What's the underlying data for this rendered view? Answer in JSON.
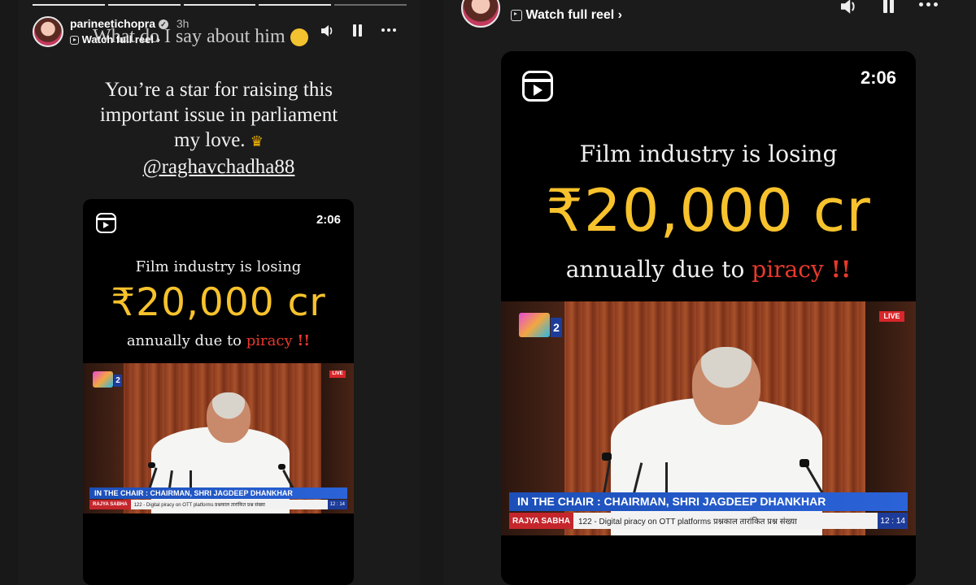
{
  "left_story": {
    "username": "parineetichopra",
    "time_ago": "3h",
    "watch_full_reel": "Watch full reel",
    "overlap_caption": "What do I say about him",
    "caption_lines": [
      "You’re a star for raising this",
      "important issue in parliament",
      "my love."
    ],
    "mention": "@raghavchadha88"
  },
  "reel": {
    "duration": "2:06",
    "line1": "Film industry is losing",
    "amount": "₹20,000 cr",
    "line3_prefix": "annually due to",
    "line3_highlight": "piracy",
    "line3_marks": "!!",
    "channel_number": "2",
    "live_label": "LIVE",
    "chair_caption": "IN THE CHAIR : CHAIRMAN, SHRI JAGDEEP DHANKHAR",
    "ticker_channel": "RAJYA SABHA",
    "ticker_text": "122 - Digital piracy on OTT platforms प्रश्नकाल  तारांकित प्रश्न संख्या",
    "ticker_time": "12 : 14"
  },
  "right_story": {
    "watch_full_reel": "Watch full reel"
  },
  "colors": {
    "amount_yellow": "#f7c22c",
    "piracy_red": "#e8392c",
    "background": "#181818"
  }
}
